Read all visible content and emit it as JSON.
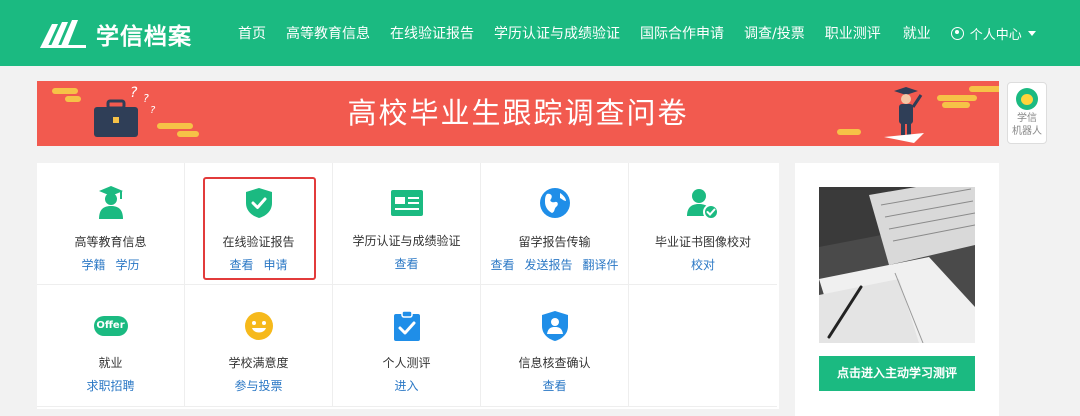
{
  "brand": {
    "name": "学信档案",
    "color": "#1bba81"
  },
  "nav": {
    "items": [
      "首页",
      "高等教育信息",
      "在线验证报告",
      "学历认证与成绩验证",
      "国际合作申请",
      "调查/投票",
      "职业测评"
    ],
    "jiuye": "就业",
    "user_center": "个人中心"
  },
  "banner": {
    "title": "高校毕业生跟踪调查问卷",
    "color": "#f25a4f"
  },
  "robot": {
    "line1": "学信",
    "line2": "机器人"
  },
  "services": [
    {
      "title": "高等教育信息",
      "links": [
        "学籍",
        "学历"
      ],
      "icon": "graduate-icon"
    },
    {
      "title": "在线验证报告",
      "links": [
        "查看",
        "申请"
      ],
      "icon": "shield-check-icon"
    },
    {
      "title": "学历认证与成绩验证",
      "links": [
        "查看"
      ],
      "icon": "id-card-icon"
    },
    {
      "title": "留学报告传输",
      "links": [
        "查看",
        "发送报告",
        "翻译件"
      ],
      "icon": "globe-icon"
    },
    {
      "title": "毕业证书图像校对",
      "links": [
        "校对"
      ],
      "icon": "user-check-icon"
    },
    {
      "title": "就业",
      "links": [
        "求职招聘"
      ],
      "icon": "offer-icon",
      "icon_text": "Offer"
    },
    {
      "title": "学校满意度",
      "links": [
        "参与投票"
      ],
      "icon": "smile-icon"
    },
    {
      "title": "个人测评",
      "links": [
        "进入"
      ],
      "icon": "clipboard-check-icon"
    },
    {
      "title": "信息核查确认",
      "links": [
        "查看"
      ],
      "icon": "user-shield-icon"
    }
  ],
  "side_card": {
    "button_label": "点击进入主动学习测评"
  }
}
